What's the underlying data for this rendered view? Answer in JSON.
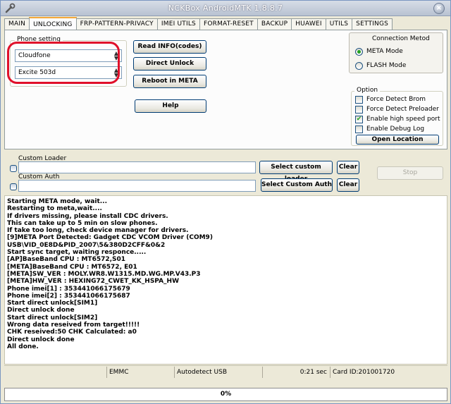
{
  "window": {
    "title": "NCKBox AndroidMTK 1.8.8.7",
    "close": "×"
  },
  "tabs": [
    "MAIN",
    "UNLOCKING",
    "FRP-PATTERN-PRIVACY",
    "IMEI UTILS",
    "FORMAT-RESET",
    "BACKUP",
    "HUAWEI",
    "UTILS",
    "SETTINGS"
  ],
  "phone_setting": {
    "legend": "Phone setting",
    "brand": "Cloudfone",
    "model": "Excite 503d"
  },
  "actions": {
    "read_info": "Read INFO(codes)",
    "direct_unlock": "Direct Unlock",
    "reboot_meta": "Reboot in META",
    "help": "Help"
  },
  "connection": {
    "legend": "Connection Metod",
    "meta": "META Mode",
    "flash": "FLASH Mode"
  },
  "option": {
    "legend": "Option",
    "force_detect_brom": "Force Detect Brom",
    "force_detect_preloader": "Force Detect Preloader",
    "high_speed_port": "Enable high speed port",
    "debug_log": "Enable Debug Log",
    "open_location": "Open Location"
  },
  "custom": {
    "loader_label": "Custom Loader",
    "auth_label": "Custom Auth",
    "select_loader": "Select custom loader",
    "select_auth": "Select Custom Auth",
    "clear": "Clear",
    "stop": "Stop"
  },
  "log": [
    "Starting META mode, wait...",
    "Restarting to meta,wait....",
    "If drivers missing, please install CDC drivers.",
    "This can take up to 5 min on slow phones.",
    "If take too long, check device manager for drivers.",
    "[9]META Port Detected: Gadget CDC VCOM Driver (COM9)",
    "USB\\VID_0E8D&PID_2007\\5&380D2CFF&0&2",
    "Start sync target, waiting responce.....",
    "[AP]BaseBand CPU : MT6572,S01",
    "[META]BaseBand CPU : MT6572, E01",
    "[META]SW_VER : MOLY.WR8.W1315.MD.WG.MP.V43.P3",
    "[META]HW_VER : HEXING72_CWET_KK_HSPA_HW",
    "Phone imei[1] : 353441066175679",
    "Phone imei[2] : 353441066175687",
    "Start direct unlock[SIM1]",
    "Direct unlock done",
    "Start direct unlock[SIM2]",
    "Wrong data reseived from target!!!!!",
    "CHK reseived:50   CHK Calculated: a0",
    "Direct unlock done",
    "All done."
  ],
  "status": {
    "storage": "EMMC",
    "connection": "Autodetect USB",
    "time": "0:21 sec",
    "card_id": "Card ID:201001720"
  },
  "progress": {
    "value": 0,
    "label": "0%"
  }
}
